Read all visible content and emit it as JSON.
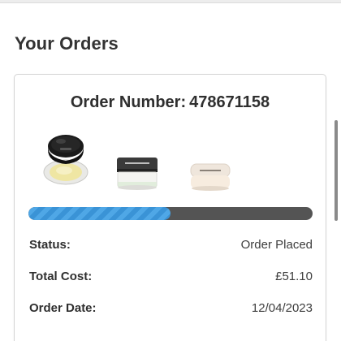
{
  "header": {
    "title": "Your Orders"
  },
  "order": {
    "number_label": "Order Number:",
    "number": "478671158",
    "products": [
      {
        "icon": "loose-powder-jar-icon"
      },
      {
        "icon": "face-cream-jar-icon"
      },
      {
        "icon": "primer-jar-icon"
      }
    ],
    "progress_fraction": 0.5,
    "progress_color": "#3a93d6",
    "status_label": "Status:",
    "status_value": "Order Placed",
    "total_label": "Total Cost:",
    "total_value": "£51.10",
    "date_label": "Order Date:",
    "date_value": "12/04/2023"
  }
}
